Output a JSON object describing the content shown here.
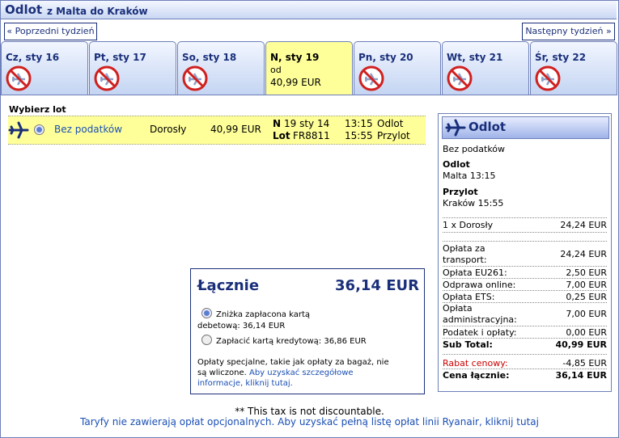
{
  "header": {
    "title": "Odlot",
    "route": "z Malta do Kraków"
  },
  "nav": {
    "prev_label": "« Poprzedni tydzień",
    "next_label": "Następny tydzień »"
  },
  "days": [
    {
      "label": "Cz, sty 16",
      "available": false
    },
    {
      "label": "Pt, sty 17",
      "available": false
    },
    {
      "label": "So, sty 18",
      "available": false
    },
    {
      "label": "N, sty 19",
      "available": true,
      "from_label": "od",
      "price": "40,99 EUR",
      "selected": true
    },
    {
      "label": "Pn, sty 20",
      "available": false
    },
    {
      "label": "Wt, sty 21",
      "available": false
    },
    {
      "label": "Śr, sty 22",
      "available": false
    }
  ],
  "flight_select": {
    "heading": "Wybierz lot",
    "fare_name": "Bez podatków",
    "passenger": "Dorosły",
    "price": "40,99 EUR",
    "day_label": "N",
    "date": "19 sty 14",
    "flight_label": "Lot",
    "flight_no": "FR8811",
    "dep_time": "13:15",
    "dep_word": "Odlot",
    "arr_time": "15:55",
    "arr_word": "Przylot"
  },
  "summary": {
    "title": "Odlot",
    "fare": "Bez podatków",
    "dep_heading": "Odlot",
    "dep_value": "Malta 13:15",
    "arr_heading": "Przylot",
    "arr_value": "Kraków 15:55",
    "lines": [
      {
        "label": "1 x Dorosły",
        "value": "24,24 EUR"
      },
      {
        "label": "Opłata za",
        "label2": "transport:",
        "value": "24,24 EUR"
      },
      {
        "label": "Opłata EU261:",
        "value": "2,50 EUR"
      },
      {
        "label": "Odprawa online:",
        "value": "7,00 EUR"
      },
      {
        "label": "Opłata ETS:",
        "value": "0,25 EUR"
      },
      {
        "label": "Opłata",
        "label2": "administracyjna:",
        "value": "7,00 EUR"
      },
      {
        "label": "Podatek i opłaty:",
        "value": "0,00 EUR"
      }
    ],
    "subtotal_label": "Sub Total:",
    "subtotal_value": "40,99 EUR",
    "discount_label": "Rabat cenowy:",
    "discount_value": "-4,85 EUR",
    "total_label": "Cena łącznie:",
    "total_value": "36,14 EUR"
  },
  "total_box": {
    "label": "Łącznie",
    "amount": "36,14 EUR",
    "option1_line1": "Zniżka zapłacona kartą",
    "option1_line2": "debetową: 36,14 EUR",
    "option2": "Zapłacić kartą kredytową: 36,86 EUR",
    "note_line1": "Opłaty specjalne, takie jak opłaty za bagaż, nie",
    "note_line2_a": "są wliczone.",
    "note_line2_b": "Aby uzyskać szczegółowe",
    "note_line3": "informacje, kliknij tutaj."
  },
  "footer": {
    "tax_note": "** This tax is not discountable.",
    "fees_link": "Taryfy nie zawierają opłat opcjonalnych. Aby uzyskać pełną listę opłat linii Ryanair, kliknij tutaj"
  },
  "colors": {
    "accent": "#1a2f7a",
    "selected_day": "#ffff99",
    "discount": "#cc0000",
    "link": "#1a4fb4"
  }
}
